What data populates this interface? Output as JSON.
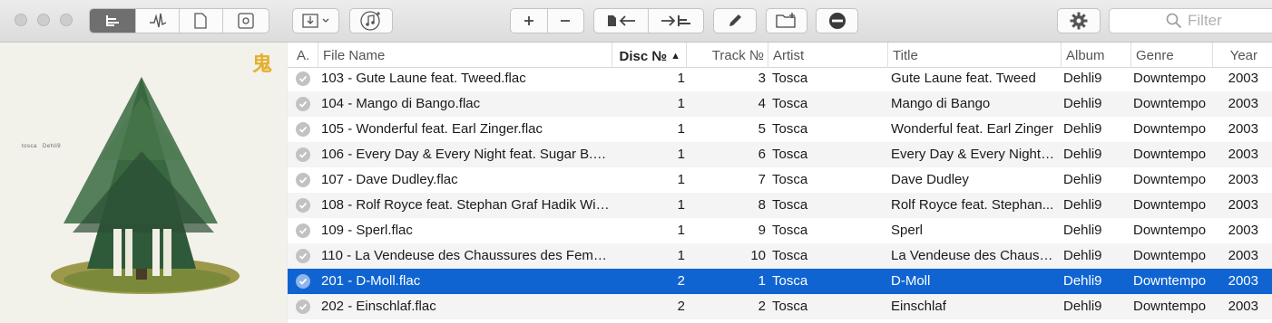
{
  "toolbar": {
    "filter_placeholder": "Filter",
    "icons": [
      "list-view-icon",
      "waveform-icon",
      "document-icon",
      "artwork-icon",
      "import-icon",
      "music-note-icon",
      "plus-icon",
      "minus-icon",
      "file-arrow-left-icon",
      "arrow-list-right-icon",
      "pencil-icon",
      "new-folder-icon",
      "remove-circle-icon",
      "gear-icon",
      "search-icon"
    ]
  },
  "artwork": {
    "label_artist": "tosca",
    "label_album": "Dehli9",
    "seal_glyph": "鬼"
  },
  "table": {
    "columns": {
      "a": "A.",
      "file_name": "File Name",
      "disc": "Disc №",
      "track": "Track №",
      "artist": "Artist",
      "title": "Title",
      "album": "Album",
      "genre": "Genre",
      "year": "Year"
    },
    "sorted_column": "disc",
    "rows": [
      {
        "file": "103 - Gute Laune feat. Tweed.flac",
        "disc": "1",
        "track": "3",
        "artist": "Tosca",
        "title": "Gute Laune feat. Tweed",
        "album": "Dehli9",
        "genre": "Downtempo",
        "year": "2003"
      },
      {
        "file": "104 - Mango di Bango.flac",
        "disc": "1",
        "track": "4",
        "artist": "Tosca",
        "title": "Mango di Bango",
        "album": "Dehli9",
        "genre": "Downtempo",
        "year": "2003"
      },
      {
        "file": "105 - Wonderful feat. Earl Zinger.flac",
        "disc": "1",
        "track": "5",
        "artist": "Tosca",
        "title": "Wonderful feat. Earl Zinger",
        "album": "Dehli9",
        "genre": "Downtempo",
        "year": "2003"
      },
      {
        "file": "106 - Every Day & Every Night feat. Sugar B..f...",
        "disc": "1",
        "track": "6",
        "artist": "Tosca",
        "title": "Every Day & Every Night f...",
        "album": "Dehli9",
        "genre": "Downtempo",
        "year": "2003"
      },
      {
        "file": "107 - Dave Dudley.flac",
        "disc": "1",
        "track": "7",
        "artist": "Tosca",
        "title": "Dave Dudley",
        "album": "Dehli9",
        "genre": "Downtempo",
        "year": "2003"
      },
      {
        "file": "108 - Rolf Royce feat. Stephan Graf Hadik Wil...",
        "disc": "1",
        "track": "8",
        "artist": "Tosca",
        "title": "Rolf Royce feat. Stephan...",
        "album": "Dehli9",
        "genre": "Downtempo",
        "year": "2003"
      },
      {
        "file": "109 - Sperl.flac",
        "disc": "1",
        "track": "9",
        "artist": "Tosca",
        "title": "Sperl",
        "album": "Dehli9",
        "genre": "Downtempo",
        "year": "2003"
      },
      {
        "file": "110 - La Vendeuse des Chaussures des Femm...",
        "disc": "1",
        "track": "10",
        "artist": "Tosca",
        "title": "La Vendeuse des Chauss...",
        "album": "Dehli9",
        "genre": "Downtempo",
        "year": "2003"
      },
      {
        "file": "201 - D-Moll.flac",
        "disc": "2",
        "track": "1",
        "artist": "Tosca",
        "title": "D-Moll",
        "album": "Dehli9",
        "genre": "Downtempo",
        "year": "2003",
        "selected": true
      },
      {
        "file": "202 - Einschlaf.flac",
        "disc": "2",
        "track": "2",
        "artist": "Tosca",
        "title": "Einschlaf",
        "album": "Dehli9",
        "genre": "Downtempo",
        "year": "2003"
      }
    ]
  },
  "colors": {
    "selection": "#0f64d2",
    "seal": "#e3b02b",
    "tree": "#2f5a3a"
  }
}
